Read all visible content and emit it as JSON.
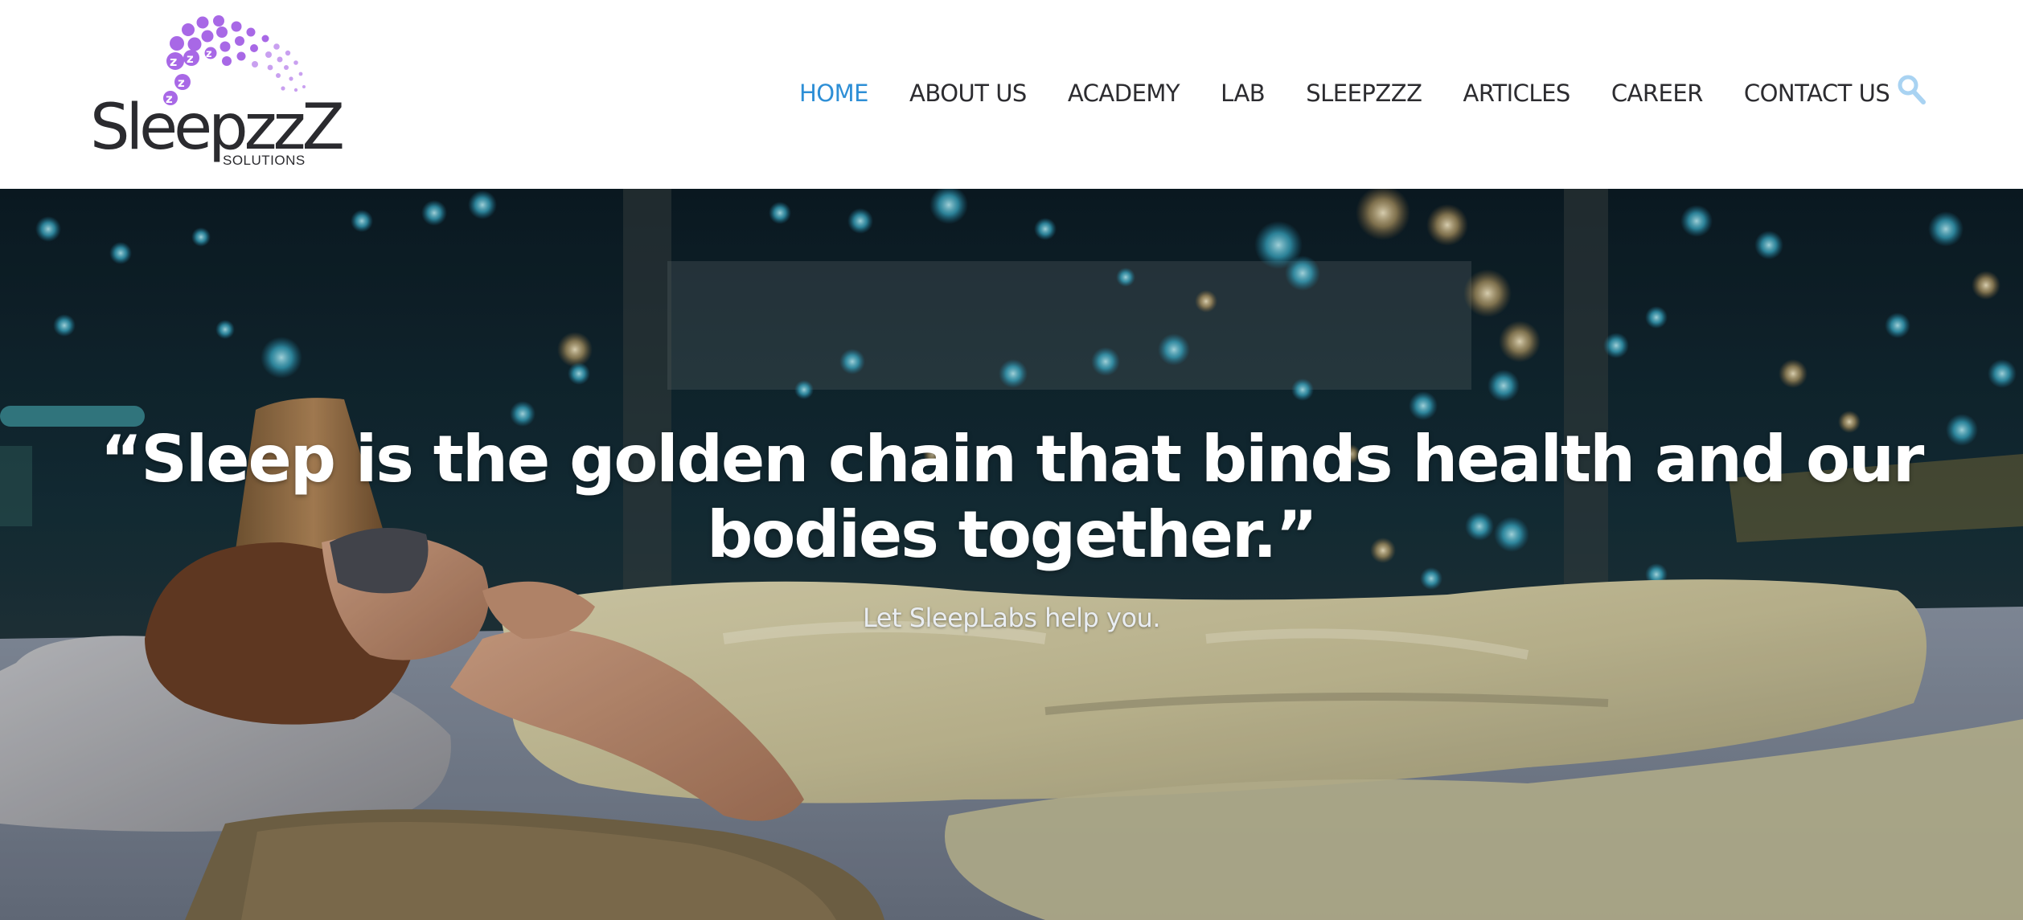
{
  "brand": {
    "name": "SleepzzZ",
    "tagline": "SOLUTIONS",
    "accent_color": "#a868e6",
    "text_color": "#2b2b2f"
  },
  "nav": {
    "active_color": "#2e8fd6",
    "items": [
      {
        "label": "HOME",
        "active": true
      },
      {
        "label": "ABOUT US",
        "active": false
      },
      {
        "label": "ACADEMY",
        "active": false
      },
      {
        "label": "LAB",
        "active": false
      },
      {
        "label": "SLEEPZZZ",
        "active": false
      },
      {
        "label": "ARTICLES",
        "active": false
      },
      {
        "label": "CAREER",
        "active": false
      },
      {
        "label": "CONTACT US",
        "active": false
      }
    ],
    "search_icon": "search-icon",
    "search_icon_color": "#a9d3f2"
  },
  "hero": {
    "quote": "“Sleep is the golden chain that binds health and our bodies together.”",
    "subtitle": "Let SleepLabs help you.",
    "image": "woman-sleeping-with-eye-mask-night-city-bokeh"
  }
}
